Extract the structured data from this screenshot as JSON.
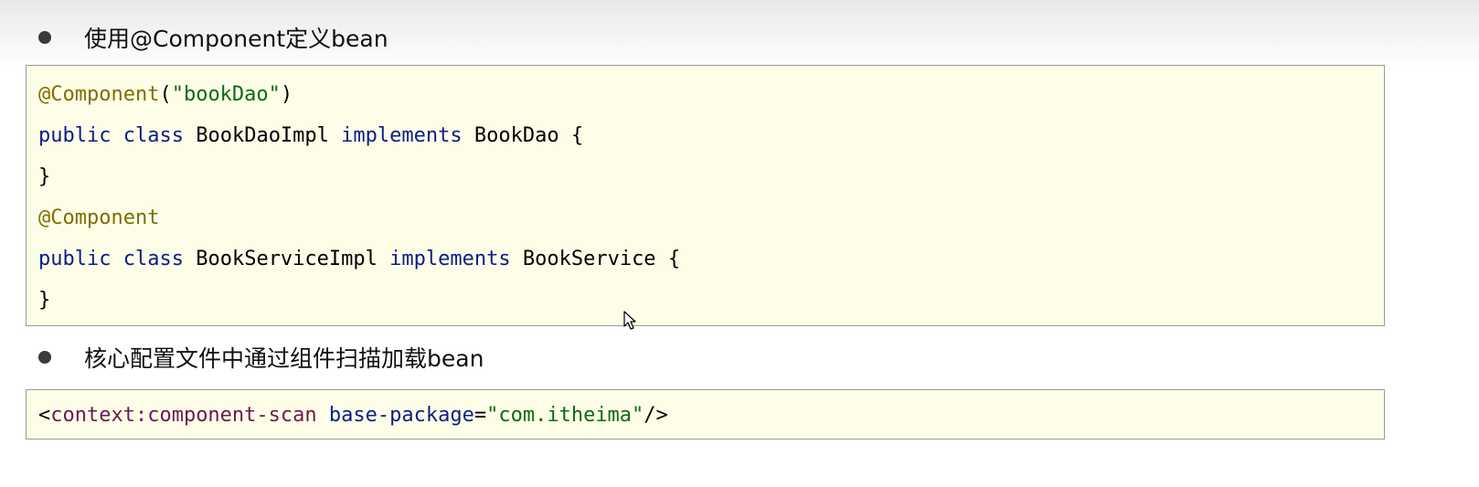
{
  "bullets": [
    {
      "text": "使用@Component定义bean"
    },
    {
      "text": "核心配置文件中通过组件扫描加载bean"
    }
  ],
  "java_code": {
    "line1": {
      "annotation": "@Component",
      "open_paren": "(",
      "string": "\"bookDao\"",
      "close_paren": ")"
    },
    "line2": {
      "kw_public": "public",
      "kw_class": "class",
      "class_name": "BookDaoImpl",
      "kw_implements": "implements",
      "interface_name": "BookDao",
      "brace": "{"
    },
    "line3": {
      "brace": "}"
    },
    "line4": {
      "annotation": "@Component"
    },
    "line5": {
      "kw_public": "public",
      "kw_class": "class",
      "class_name": "BookServiceImpl",
      "kw_implements": "implements",
      "interface_name": "BookService",
      "brace": "{"
    },
    "line6": {
      "brace": "}"
    }
  },
  "xml_code": {
    "open": "<",
    "tag": "context:component-scan",
    "attr_name": "base-package",
    "equals": "=",
    "attr_value": "\"com.itheima\"",
    "close": "/>"
  },
  "colors": {
    "keyword": "#0a1f87",
    "annotation": "#7d6f00",
    "string": "#0a6b12",
    "xml_tag": "#6b1a52",
    "code_background": "#fefde8"
  },
  "icons": {
    "cursor": "mouse-pointer-icon"
  }
}
